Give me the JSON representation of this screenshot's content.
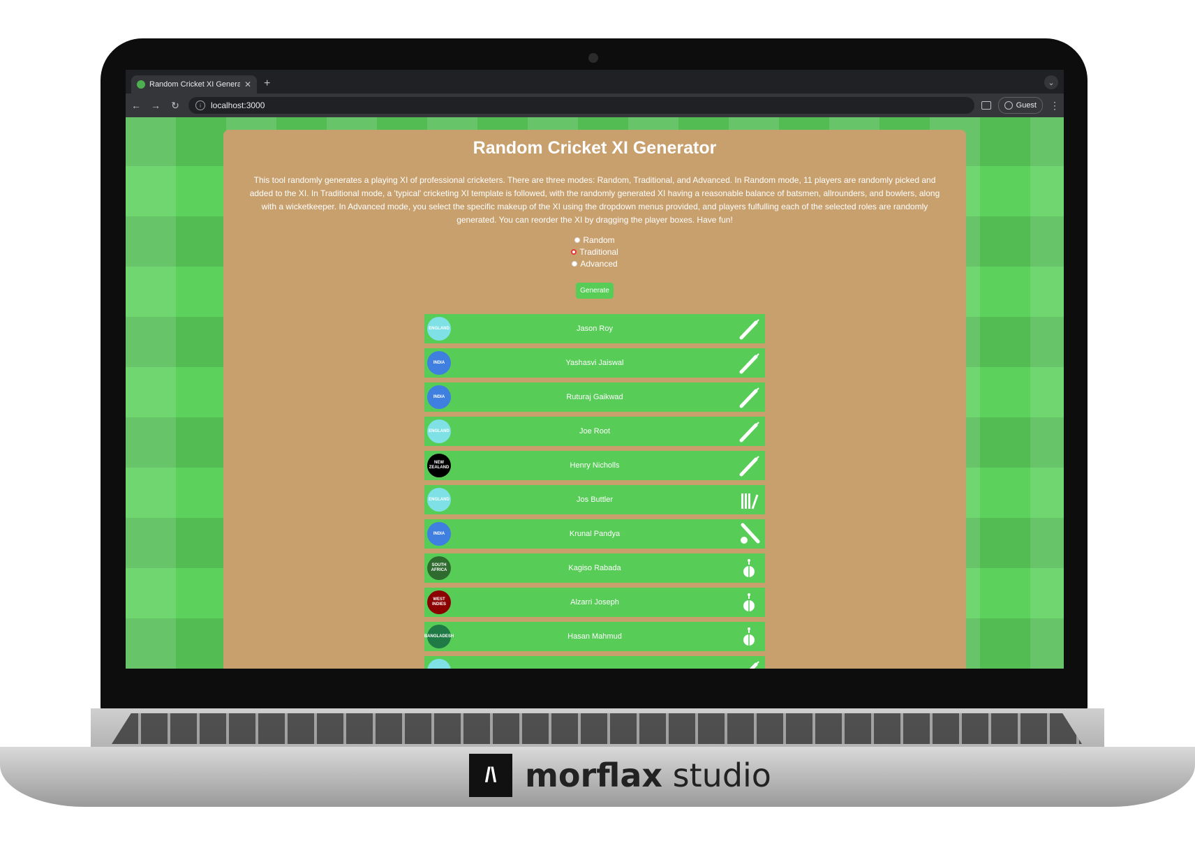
{
  "browser": {
    "tab_title": "Random Cricket XI Generator",
    "url": "localhost:3000",
    "profile_label": "Guest"
  },
  "page": {
    "title": "Random Cricket XI Generator",
    "description": "This tool randomly generates a playing XI of professional cricketers. There are three modes: Random, Traditional, and Advanced. In Random mode, 11 players are randomly picked and added to the XI. In Traditional mode, a 'typical' cricketing XI template is followed, with the randomly generated XI having a reasonable balance of batsmen, allrounders, and bowlers, along with a wicketkeeper. In Advanced mode, you select the specific makeup of the XI using the dropdown menus provided, and players fulfulling each of the selected roles are randomly generated. You can reorder the XI by dragging the player boxes. Have fun!",
    "modes": [
      {
        "label": "Random",
        "selected": false
      },
      {
        "label": "Traditional",
        "selected": true
      },
      {
        "label": "Advanced",
        "selected": false
      }
    ],
    "generate_label": "Generate"
  },
  "players": [
    {
      "name": "Jason Roy",
      "team": "ENGLAND",
      "team_color": "#7fe0e6",
      "role": "bat"
    },
    {
      "name": "Yashasvi Jaiswal",
      "team": "INDIA",
      "team_color": "#3f7fe0",
      "role": "bat"
    },
    {
      "name": "Ruturaj Gaikwad",
      "team": "INDIA",
      "team_color": "#3f7fe0",
      "role": "bat"
    },
    {
      "name": "Joe Root",
      "team": "ENGLAND",
      "team_color": "#7fe0e6",
      "role": "bat"
    },
    {
      "name": "Henry Nicholls",
      "team": "NEW ZEALAND",
      "team_color": "#000000",
      "role": "bat"
    },
    {
      "name": "Jos Buttler",
      "team": "ENGLAND",
      "team_color": "#7fe0e6",
      "role": "wk"
    },
    {
      "name": "Krunal Pandya",
      "team": "INDIA",
      "team_color": "#3f7fe0",
      "role": "ar"
    },
    {
      "name": "Kagiso Rabada",
      "team": "SOUTH AFRICA",
      "team_color": "#2f6b2f",
      "role": "bowl"
    },
    {
      "name": "Alzarri Joseph",
      "team": "WEST INDIES",
      "team_color": "#8b0000",
      "role": "bowl"
    },
    {
      "name": "Hasan Mahmud",
      "team": "BANGLADESH",
      "team_color": "#1f7a45",
      "role": "bowl"
    },
    {
      "name": "",
      "team": "",
      "team_color": "#7fe0e6",
      "role": "bat"
    }
  ],
  "frame": {
    "brand_name": "morflax",
    "brand_suffix": "studio"
  }
}
